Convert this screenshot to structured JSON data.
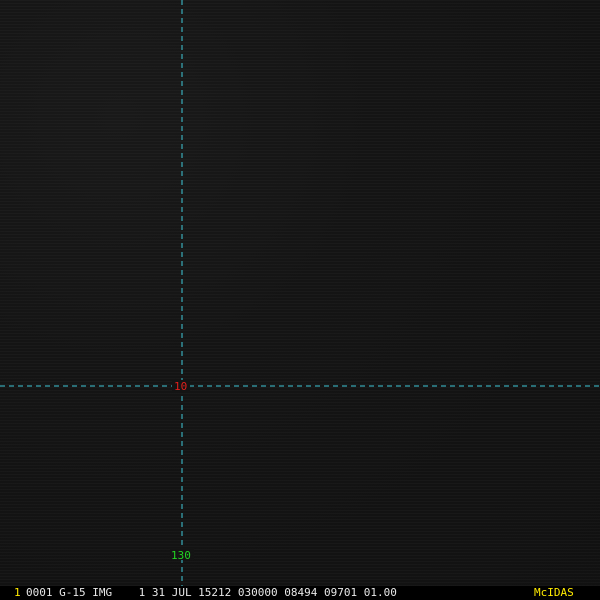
{
  "colors": {
    "background": "#141414",
    "grid_line": "#3fc9d9",
    "latitude_label": "#e0201c",
    "longitude_label": "#22d422",
    "frame_number": "#ffea00",
    "status_text": "#e8e8e8",
    "brand": "#ffea00"
  },
  "grid": {
    "latitude_label": "10",
    "longitude_label": "130"
  },
  "status_bar": {
    "frame_number": "1",
    "text": "0001 G-15 IMG    1 31 JUL 15212 030000 08494 09701 01.00",
    "brand": "McIDAS"
  }
}
